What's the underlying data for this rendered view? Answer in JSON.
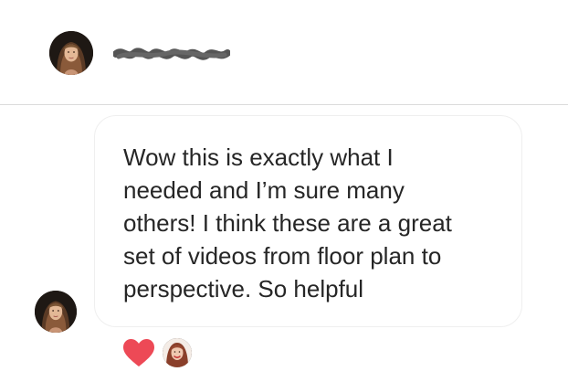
{
  "header": {
    "avatar_icon": "profile-photo",
    "username_redacted": true
  },
  "message": {
    "text": "Wow this is exactly what I needed and I’m sure many others! I think these are a great set of videos from floor plan to perspective. So helpful",
    "lines": [
      "Wow this is exactly what I",
      "needed and I’m sure many",
      "others! I think these are a great",
      "set of videos from floor plan to",
      "perspective. So helpful"
    ],
    "sender_avatar_icon": "profile-photo"
  },
  "reactions": {
    "emoji_icon": "heart-icon",
    "heart_color": "#ed4956",
    "reactor_avatar_icon": "profile-photo"
  },
  "colors": {
    "text": "#262626",
    "divider": "#dbdbdb",
    "bubble_border": "#efefef"
  }
}
